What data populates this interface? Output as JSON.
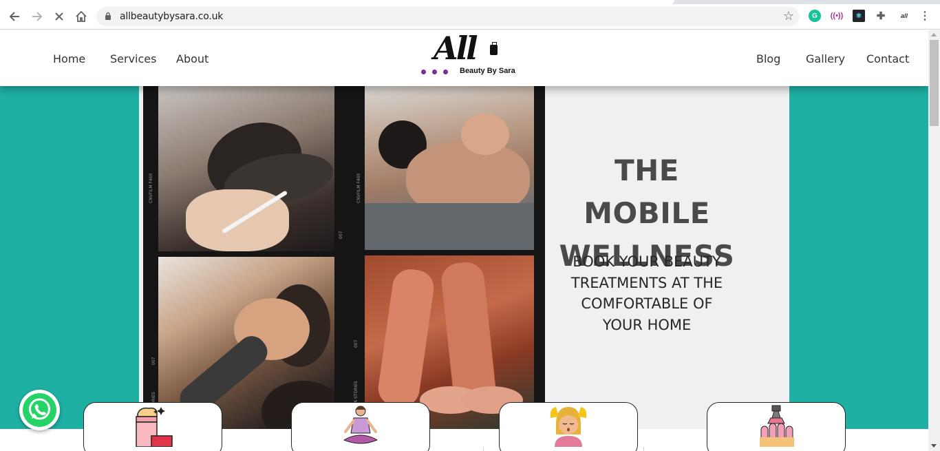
{
  "browser": {
    "url": "allbeautybysara.co.uk",
    "back_icon": "back-arrow-icon",
    "forward_icon": "forward-arrow-icon",
    "stop_icon": "stop-loading-icon",
    "home_icon": "home-icon",
    "extensions": [
      "grammarly-icon",
      "cast-icon",
      "react-devtools-icon",
      "puzzle-extensions-icon",
      "site-favicon"
    ]
  },
  "header": {
    "nav_left": [
      "Home",
      "Services",
      "About"
    ],
    "nav_right": [
      "Blog",
      "Gallery",
      "Contact"
    ],
    "logo": {
      "word": "All",
      "subtitle": "Beauty By Sara",
      "dot_color": "#7b2d8e"
    }
  },
  "hero": {
    "background_color": "#1fb0a4",
    "title": "THE MOBILE WELLNESS",
    "subtitle": "BOOK YOUR BEAUTY TREATMENTS AT THE COMFORTABLE OF YOUR HOME",
    "film_labels": [
      "CNVFILM F400",
      "CNVFILM F400",
      "007",
      "007",
      "007",
      "STORIES",
      "A STORIES"
    ]
  },
  "cards": [
    {
      "icon": "skincare-cream-icon"
    },
    {
      "icon": "yoga-meditation-icon"
    },
    {
      "icon": "head-massage-icon"
    },
    {
      "icon": "nail-polish-icon"
    }
  ],
  "floating": {
    "whatsapp_icon": "whatsapp-icon",
    "whatsapp_color": "#25d366"
  }
}
